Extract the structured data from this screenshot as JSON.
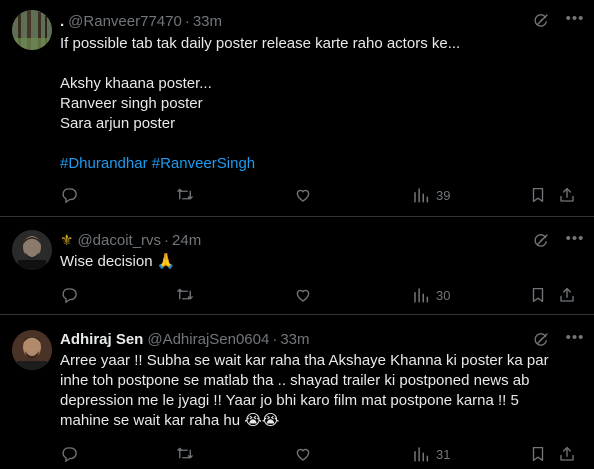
{
  "tweets": [
    {
      "display_name": ".",
      "handle": "@Ranveer77470",
      "separator": "·",
      "time": "33m",
      "lines": [
        "If possible tab tak daily poster release karte raho actors ke...",
        "",
        "Akshy khaana poster...",
        "Ranveer singh poster",
        "Sara arjun poster",
        ""
      ],
      "hashtags": [
        "#Dhurandhar",
        "#RanveerSingh"
      ],
      "views": "39"
    },
    {
      "display_name": "⚜",
      "handle": "@dacoit_rvs",
      "separator": "·",
      "time": "24m",
      "lines": [
        "Wise decision 🙏"
      ],
      "views": "30"
    },
    {
      "display_name": "Adhiraj Sen",
      "handle": "@AdhirajSen0604",
      "separator": "·",
      "time": "33m",
      "lines": [
        "Arree yaar !! Subha se wait kar raha tha Akshaye Khanna ki poster ka par",
        "inhe toh postpone se matlab tha .. shayad trailer ki postponed news ab",
        "depression me le jyagi !! Yaar jo bhi karo film mat postpone karna !! 5",
        "mahine se wait kar raha hu 😭😭"
      ],
      "views": "31"
    }
  ],
  "icons": {
    "reply": "reply-icon",
    "repost": "repost-icon",
    "like": "like-icon",
    "views": "views-icon",
    "bookmark": "bookmark-icon",
    "share": "share-icon",
    "grok": "grok-icon",
    "more": "more-icon"
  },
  "colors": {
    "background": "#000000",
    "text": "#e7e9ea",
    "muted": "#71767b",
    "link": "#1d9bf0",
    "divider": "#2f3336"
  }
}
